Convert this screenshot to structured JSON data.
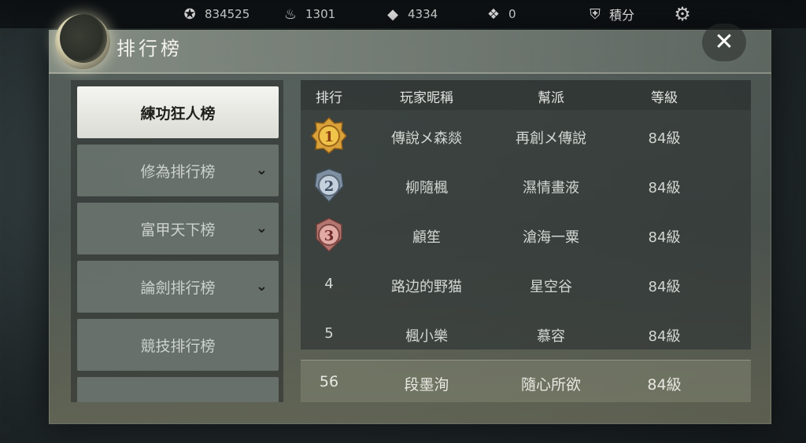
{
  "resources": {
    "coins": "834525",
    "ingots": "1301",
    "jade": "4334",
    "boxes": "0",
    "score_label": "積分"
  },
  "panel": {
    "title": "排行榜",
    "close_label": "✕"
  },
  "nav": {
    "items": [
      {
        "label": "練功狂人榜",
        "active": true,
        "expandable": false
      },
      {
        "label": "修為排行榜",
        "active": false,
        "expandable": true
      },
      {
        "label": "富甲天下榜",
        "active": false,
        "expandable": true
      },
      {
        "label": "論劍排行榜",
        "active": false,
        "expandable": true
      },
      {
        "label": "競技排行榜",
        "active": false,
        "expandable": false
      }
    ]
  },
  "table": {
    "headers": {
      "rank": "排行",
      "name": "玩家昵稱",
      "guild": "幫派",
      "level": "等級"
    },
    "rows": [
      {
        "rank": "1",
        "name": "傳說メ森燚",
        "guild": "再創メ傳說",
        "level": "84級"
      },
      {
        "rank": "2",
        "name": "柳隨楓",
        "guild": "濕情畫液",
        "level": "84級"
      },
      {
        "rank": "3",
        "name": "顧笙",
        "guild": "滄海一粟",
        "level": "84級"
      },
      {
        "rank": "4",
        "name": "路边的野猫",
        "guild": "星空谷",
        "level": "84級"
      },
      {
        "rank": "5",
        "name": "楓小樂",
        "guild": "慕容",
        "level": "84級"
      }
    ],
    "self": {
      "rank": "56",
      "name": "段墨洵",
      "guild": "隨心所欲",
      "level": "84級"
    }
  },
  "colors": {
    "gold": "#d9a23a",
    "silver": "#9aa8b8",
    "bronze": "#c98a86"
  }
}
